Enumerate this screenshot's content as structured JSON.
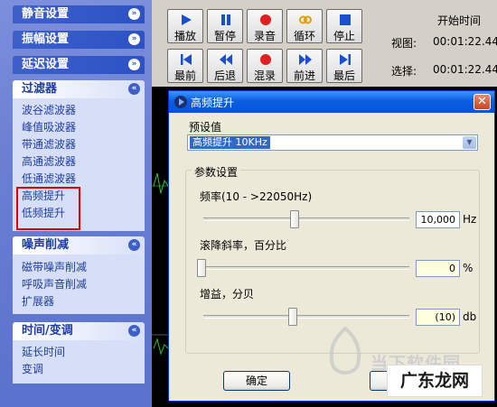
{
  "left_pane": {
    "groups": [
      {
        "title": "静音设置",
        "expanded": false
      },
      {
        "title": "振幅设置",
        "expanded": false
      },
      {
        "title": "延迟设置",
        "expanded": false
      },
      {
        "title": "过滤器",
        "expanded": true,
        "items": [
          "波谷滤波器",
          "峰值吸波器",
          "带通滤波器",
          "高通滤波器",
          "低通滤波器",
          "高频提升",
          "低频提升"
        ]
      },
      {
        "title": "噪声削减",
        "expanded": true,
        "items": [
          "磁带噪声削减",
          "呼吸声音削减",
          "扩展器"
        ]
      },
      {
        "title": "时间/变调",
        "expanded": true,
        "items": [
          "延长时间",
          "变调"
        ]
      }
    ],
    "chevron_down": "»",
    "chevron_up": "«"
  },
  "toolbar": {
    "row1": [
      {
        "label": "播放",
        "icon": "play-icon"
      },
      {
        "label": "暂停",
        "icon": "pause-icon"
      },
      {
        "label": "录音",
        "icon": "record-icon"
      },
      {
        "label": "循环",
        "icon": "loop-icon"
      },
      {
        "label": "停止",
        "icon": "stop-icon"
      }
    ],
    "row2": [
      {
        "label": "最前",
        "icon": "skip-start-icon"
      },
      {
        "label": "后退",
        "icon": "rewind-icon"
      },
      {
        "label": "混录",
        "icon": "mix-record-icon"
      },
      {
        "label": "前进",
        "icon": "fast-forward-icon"
      },
      {
        "label": "最后",
        "icon": "skip-end-icon"
      }
    ],
    "start_time_label": "开始时间",
    "view_label": "视图:",
    "view_time": "00:01:22.44",
    "selection_label": "选择:",
    "selection_time": "00:01:22.44"
  },
  "dialog": {
    "title": "高频提升",
    "preset_label": "预设值",
    "preset_value": "高频提升 10KHz",
    "params_group": "参数设置",
    "frequency_label": "频率(10 - >22050Hz)",
    "frequency_value": "10,000",
    "frequency_unit": "Hz",
    "rolloff_label": "滚降斜率，百分比",
    "rolloff_value": "0",
    "rolloff_unit": "%",
    "gain_label": "增益，分贝",
    "gain_value": "(10)",
    "gain_unit": "db",
    "ok_button": "确定",
    "cancel_button": "取"
  },
  "watermark": {
    "line1": "当下软件园",
    "line2": "广东龙网"
  },
  "colors": {
    "accent": "#2c52c4",
    "highlight_box": "#e40000",
    "record_red": "#e02020",
    "play_blue": "#1a4fd0"
  }
}
